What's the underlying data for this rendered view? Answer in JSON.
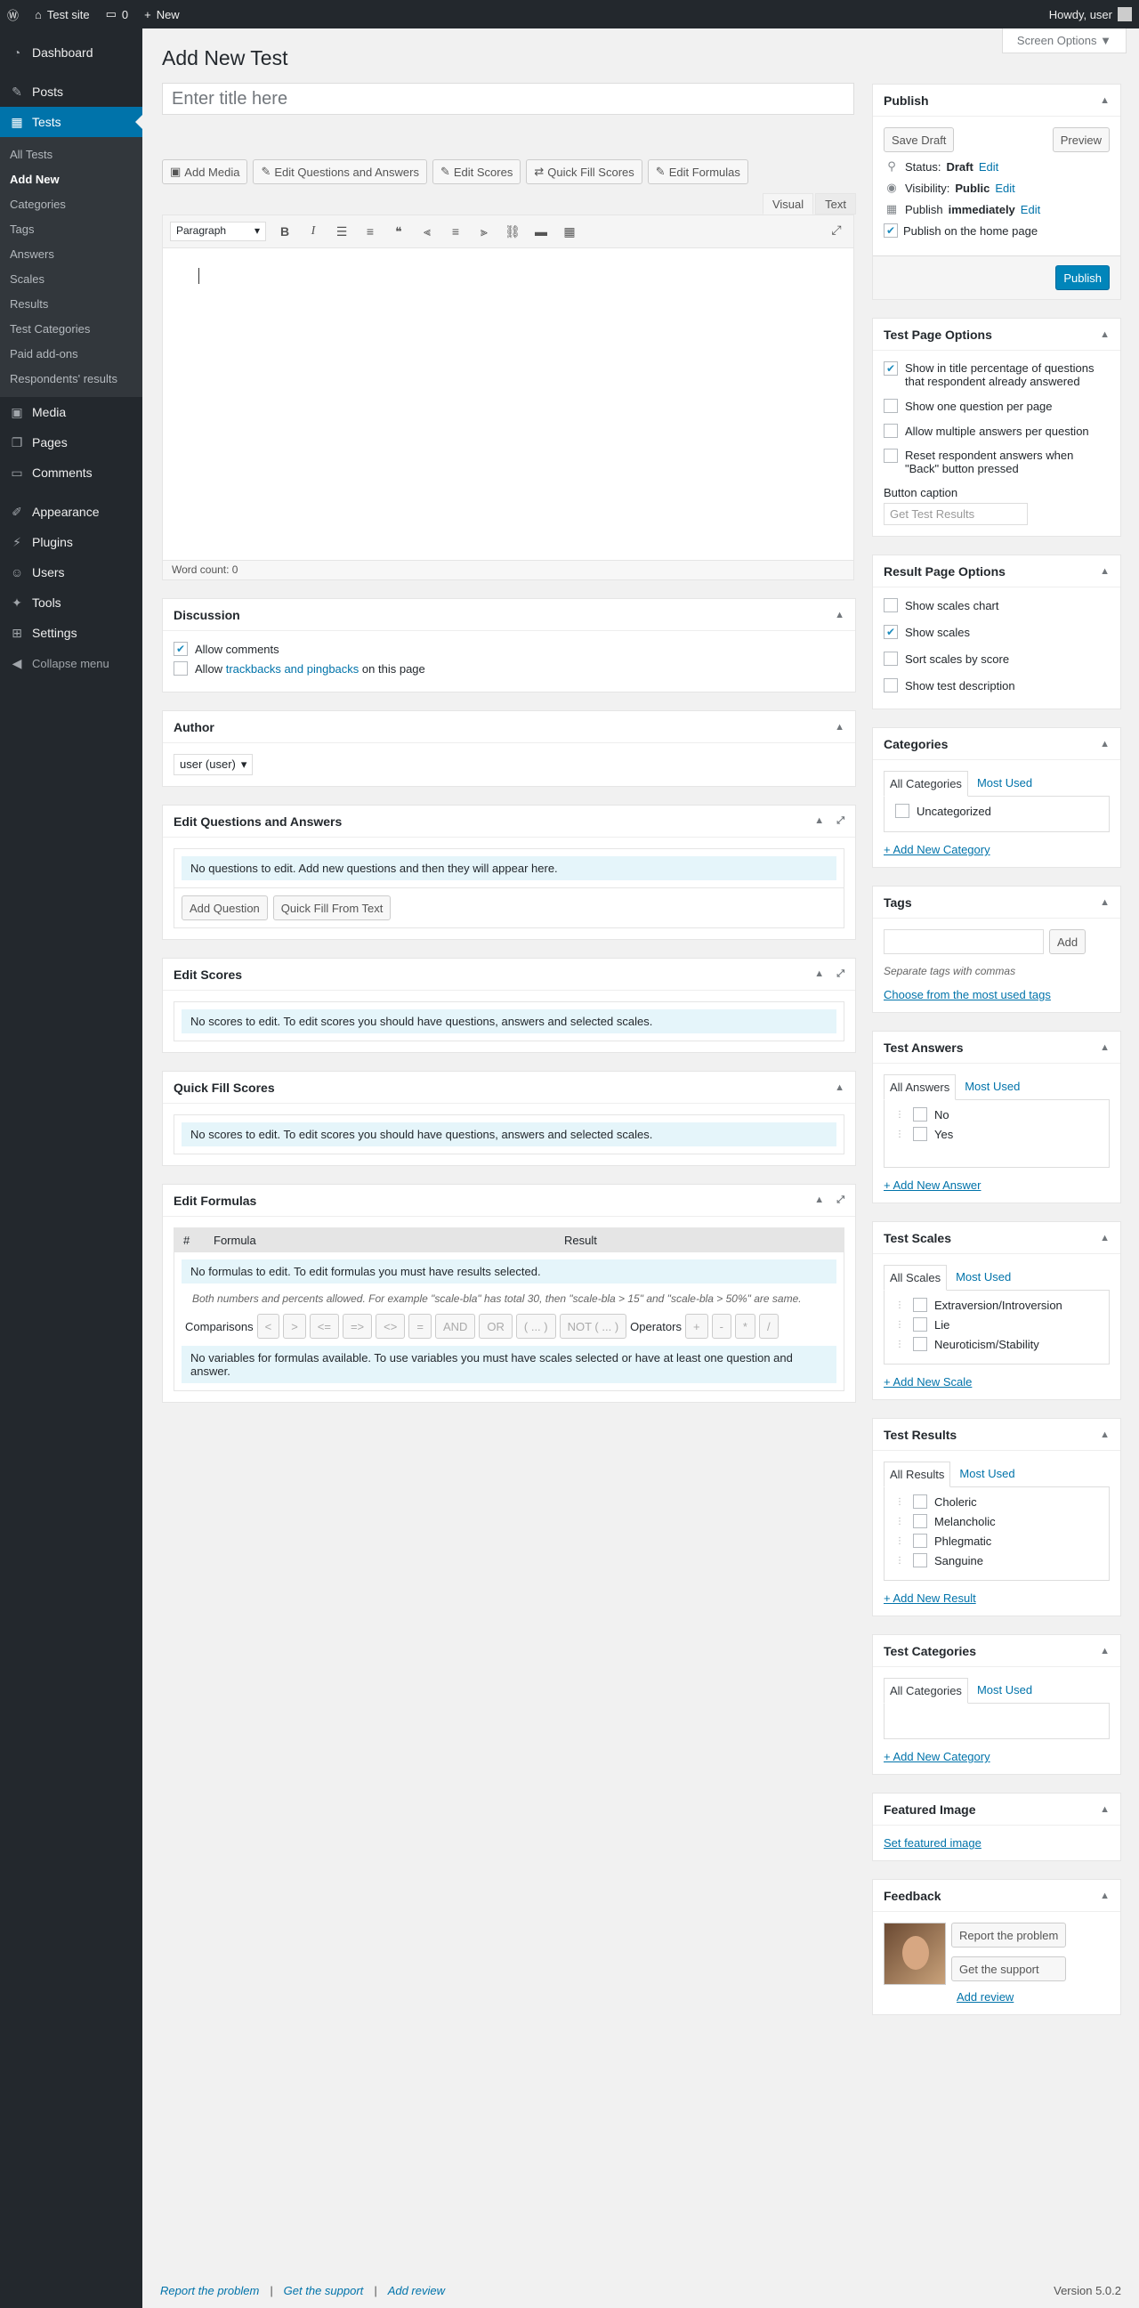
{
  "adminbar": {
    "site": "Test site",
    "comments": "0",
    "new": "New",
    "howdy": "Howdy, user"
  },
  "menu": {
    "dashboard": "Dashboard",
    "posts": "Posts",
    "tests": "Tests",
    "tests_sub": [
      "All Tests",
      "Add New",
      "Categories",
      "Tags",
      "Answers",
      "Scales",
      "Results",
      "Test Categories",
      "Paid add-ons",
      "Respondents' results"
    ],
    "after": [
      "Media",
      "Pages",
      "Comments"
    ],
    "after2": [
      "Appearance",
      "Plugins",
      "Users",
      "Tools",
      "Settings"
    ],
    "collapse": "Collapse menu"
  },
  "screen_options": "Screen Options ▼",
  "page_title": "Add New Test",
  "title_placeholder": "Enter title here",
  "media_buttons": [
    "Add Media",
    "Edit Questions and Answers",
    "Edit Scores",
    "Quick Fill Scores",
    "Edit Formulas"
  ],
  "editor": {
    "tab_visual": "Visual",
    "tab_text": "Text",
    "format": "Paragraph",
    "word_count": "Word count: 0"
  },
  "discussion": {
    "title": "Discussion",
    "allow_comments": "Allow comments",
    "allow_pre": "Allow",
    "allow_link": "trackbacks and pingbacks",
    "allow_post": "on this page"
  },
  "author": {
    "title": "Author",
    "value": "user (user)"
  },
  "edit_qa": {
    "title": "Edit Questions and Answers",
    "note": "No questions to edit. Add new questions and then they will appear here.",
    "add": "Add Question",
    "quick": "Quick Fill From Text"
  },
  "edit_scores": {
    "title": "Edit Scores",
    "note": "No scores to edit. To edit scores you should have questions, answers and selected scales."
  },
  "quick_fill": {
    "title": "Quick Fill Scores",
    "note": "No scores to edit. To edit scores you should have questions, answers and selected scales."
  },
  "formulas": {
    "title": "Edit Formulas",
    "col_num": "#",
    "col_formula": "Formula",
    "col_result": "Result",
    "note": "No formulas to edit. To edit formulas you must have results selected.",
    "help": "Both numbers and percents allowed. For example \"scale-bla\" has total 30, then \"scale-bla > 15\" and \"scale-bla > 50%\" are same.",
    "comparisons_label": "Comparisons",
    "comparisons": [
      "<",
      ">",
      "<=",
      "=>",
      "<>",
      "=",
      "AND",
      "OR",
      "( ... )",
      "NOT ( ... )"
    ],
    "operators_label": "Operators",
    "operators": [
      "+",
      "-",
      "*",
      "/"
    ],
    "vars_note": "No variables for formulas available. To use variables you must have scales selected or have at least one question and answer."
  },
  "publish": {
    "title": "Publish",
    "save_draft": "Save Draft",
    "preview": "Preview",
    "status_label": "Status:",
    "status": "Draft",
    "visibility_label": "Visibility:",
    "visibility": "Public",
    "publish_label": "Publish",
    "publish_when": "immediately",
    "edit": "Edit",
    "home": "Publish on the home page",
    "button": "Publish"
  },
  "test_page_options": {
    "title": "Test Page Options",
    "items": [
      {
        "label": "Show in title percentage of questions that respondent already answered",
        "checked": true
      },
      {
        "label": "Show one question per page",
        "checked": false
      },
      {
        "label": "Allow multiple answers per question",
        "checked": false
      },
      {
        "label": "Reset respondent answers when \"Back\" button pressed",
        "checked": false
      }
    ],
    "caption_label": "Button caption",
    "caption_placeholder": "Get Test Results"
  },
  "result_page_options": {
    "title": "Result Page Options",
    "items": [
      {
        "label": "Show scales chart",
        "checked": false
      },
      {
        "label": "Show scales",
        "checked": true
      },
      {
        "label": "Sort scales by score",
        "checked": false
      },
      {
        "label": "Show test description",
        "checked": false
      }
    ]
  },
  "categories": {
    "title": "Categories",
    "tab1": "All Categories",
    "tab2": "Most Used",
    "items": [
      "Uncategorized"
    ],
    "add": "+ Add New Category"
  },
  "tags": {
    "title": "Tags",
    "add": "Add",
    "hint": "Separate tags with commas",
    "choose": "Choose from the most used tags"
  },
  "test_answers": {
    "title": "Test Answers",
    "tab1": "All Answers",
    "tab2": "Most Used",
    "items": [
      "No",
      "Yes"
    ],
    "add": "+ Add New Answer"
  },
  "test_scales": {
    "title": "Test Scales",
    "tab1": "All Scales",
    "tab2": "Most Used",
    "items": [
      "Extraversion/Introversion",
      "Lie",
      "Neuroticism/Stability"
    ],
    "add": "+ Add New Scale"
  },
  "test_results": {
    "title": "Test Results",
    "tab1": "All Results",
    "tab2": "Most Used",
    "items": [
      "Choleric",
      "Melancholic",
      "Phlegmatic",
      "Sanguine"
    ],
    "add": "+ Add New Result"
  },
  "test_categories": {
    "title": "Test Categories",
    "tab1": "All Categories",
    "tab2": "Most Used",
    "add": "+ Add New Category"
  },
  "featured": {
    "title": "Featured Image",
    "link": "Set featured image"
  },
  "feedback": {
    "title": "Feedback",
    "report": "Report the problem",
    "support": "Get the support",
    "review": "Add review"
  },
  "footer": {
    "report": "Report the problem",
    "sep": "|",
    "support": "Get the support",
    "review": "Add review",
    "version": "Version 5.0.2"
  }
}
